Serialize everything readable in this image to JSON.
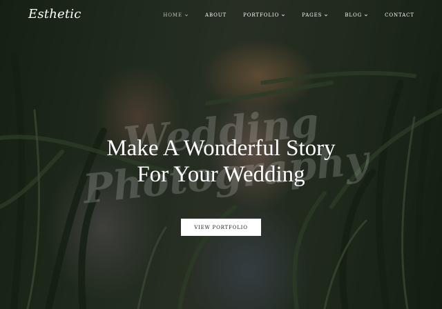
{
  "brand": {
    "logo_text": "Esthetic"
  },
  "nav": {
    "items": [
      {
        "label": "HOME",
        "has_dropdown": true,
        "active": true
      },
      {
        "label": "ABOUT",
        "has_dropdown": false,
        "active": false
      },
      {
        "label": "PORTFOLIO",
        "has_dropdown": true,
        "active": false
      },
      {
        "label": "PAGES",
        "has_dropdown": true,
        "active": false
      },
      {
        "label": "BLOG",
        "has_dropdown": true,
        "active": false
      },
      {
        "label": "CONTACT",
        "has_dropdown": false,
        "active": false
      }
    ]
  },
  "hero": {
    "headline_line1": "Make A Wonderful Story",
    "headline_line2": "For Your Wedding",
    "watermark_line1": "Wedding",
    "watermark_line2": "Photography",
    "cta_label": "VIEW PORTFOLIO",
    "image_subject": "couple-in-tall-grass-photo"
  },
  "colors": {
    "text": "#ffffff",
    "active_nav": "#bfbfbf",
    "button_bg": "#ffffff",
    "button_text": "#1a1a1a"
  }
}
